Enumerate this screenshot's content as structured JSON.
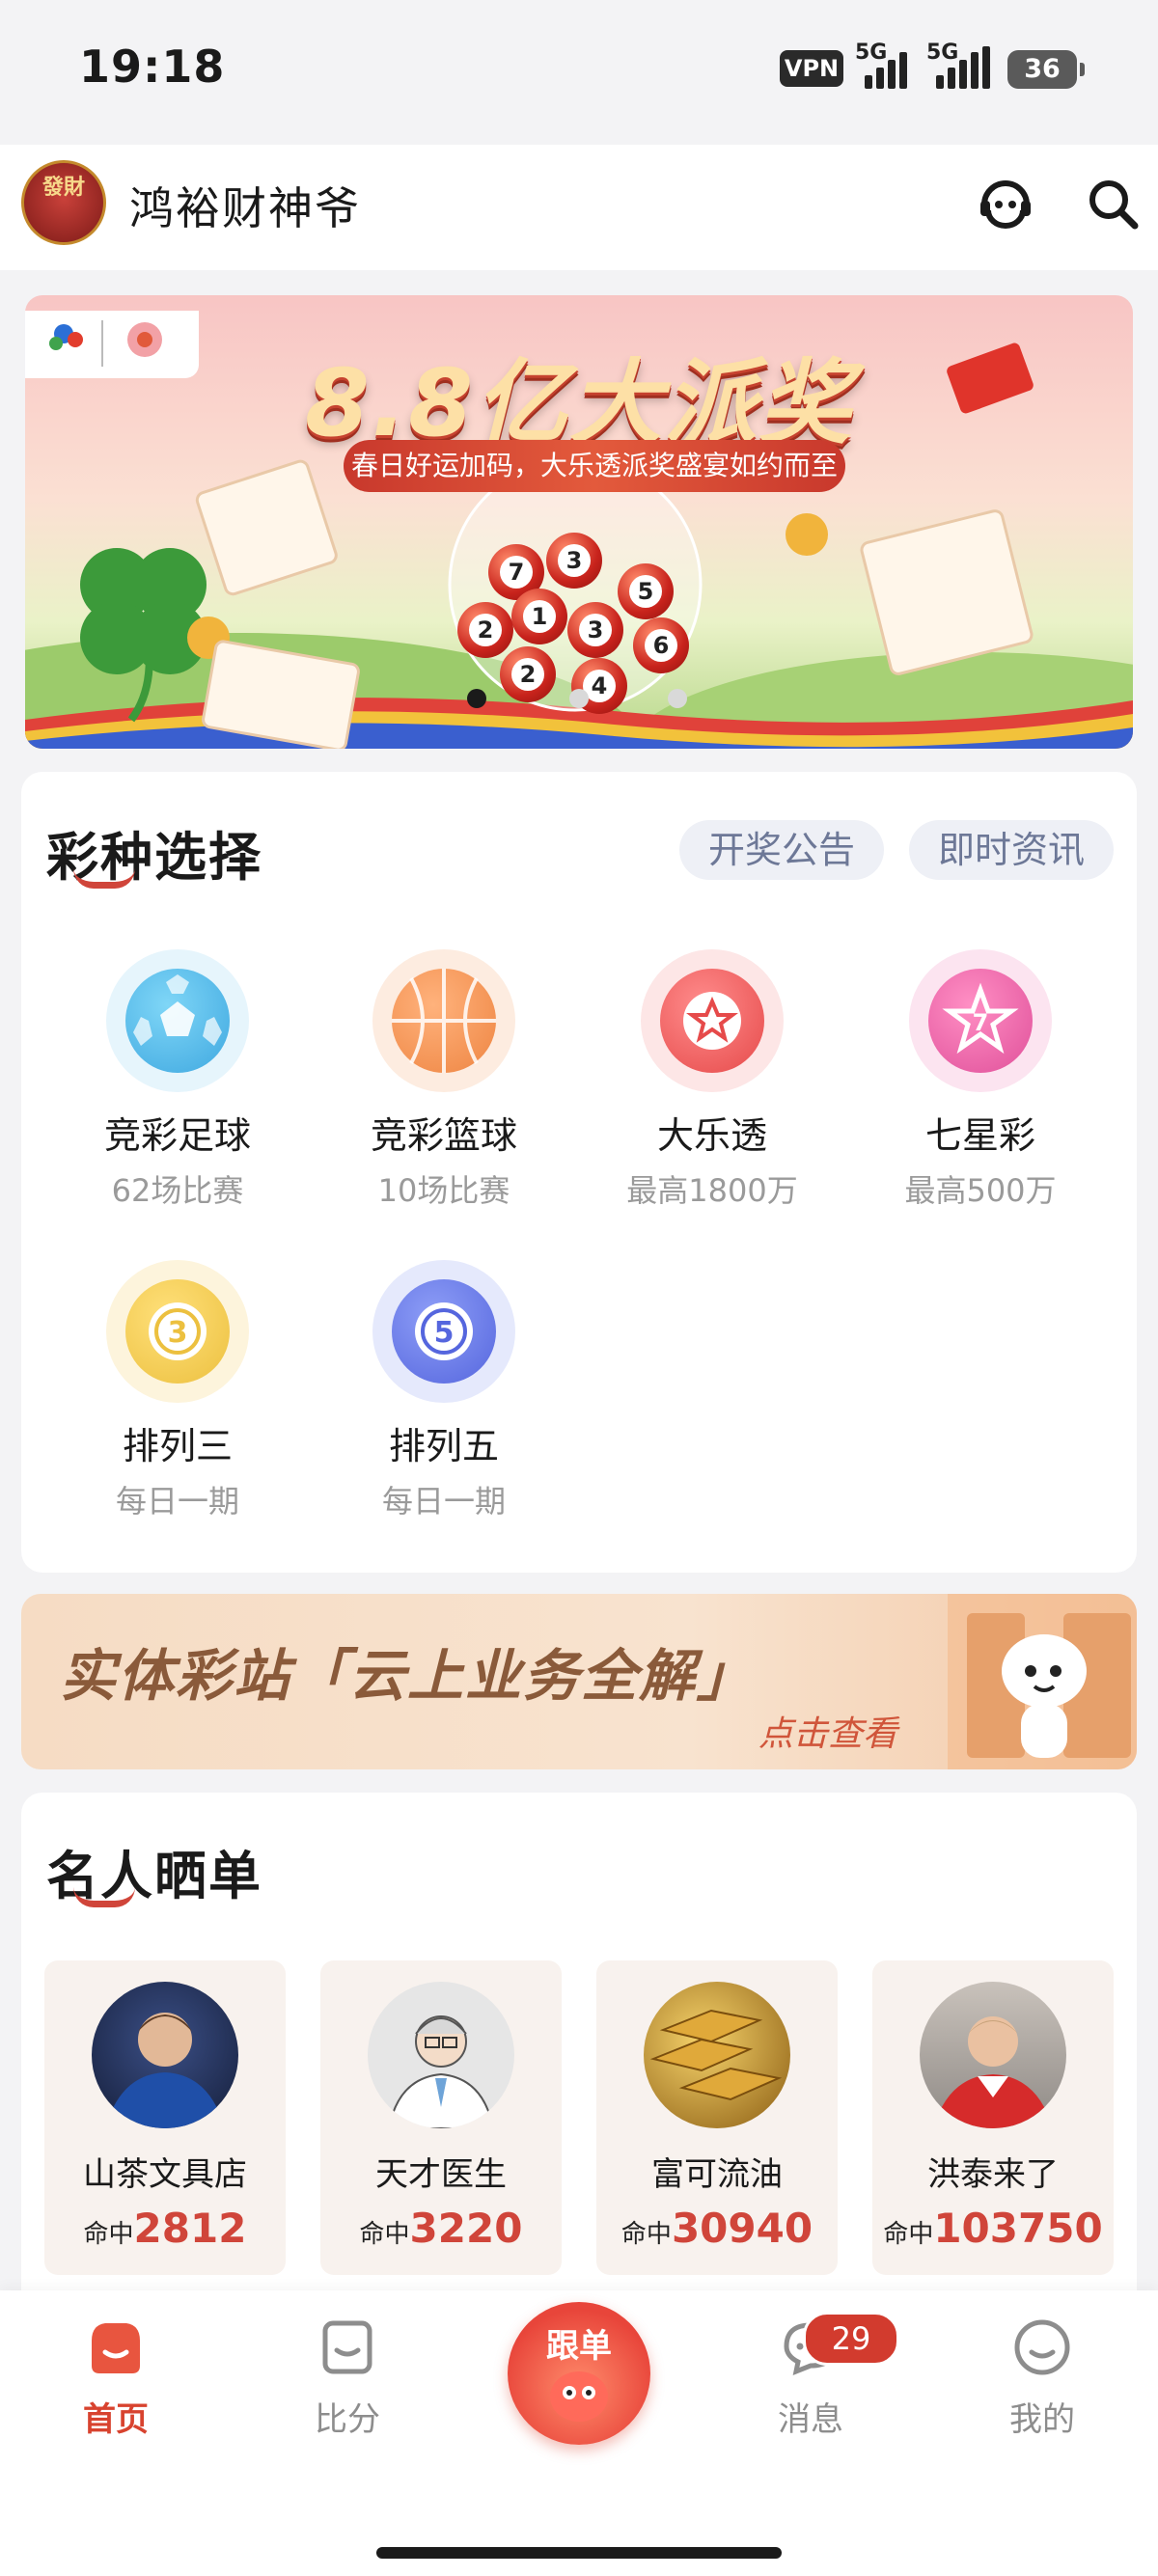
{
  "status_bar": {
    "time": "19:18",
    "vpn": "VPN",
    "net1": "5G",
    "net2": "5G",
    "battery": "36"
  },
  "header": {
    "app_name": "鸿裕财神爷",
    "logo_text": "發財"
  },
  "banner": {
    "title": "8.8亿大派奖",
    "subtitle": "春日好运加码，大乐透派奖盛宴如约而至",
    "balls": [
      "7",
      "3",
      "1",
      "5",
      "2",
      "3",
      "6",
      "2",
      "4"
    ],
    "slide_count": 3,
    "active_slide": 1
  },
  "lottery_section": {
    "title": "彩种选择",
    "pills": [
      "开奖公告",
      "即时资讯"
    ],
    "items": [
      {
        "name": "竞彩足球",
        "desc": "62场比赛",
        "icon": "soccer-ball-icon",
        "color": "#5cc3ee"
      },
      {
        "name": "竞彩篮球",
        "desc": "10场比赛",
        "icon": "basketball-icon",
        "color": "#f39a55"
      },
      {
        "name": "大乐透",
        "desc": "最高1800万",
        "icon": "star-ball-icon",
        "color": "#ec5a5a"
      },
      {
        "name": "七星彩",
        "desc": "最高500万",
        "icon": "seven-star-icon",
        "color": "#e6609e"
      },
      {
        "name": "排列三",
        "desc": "每日一期",
        "icon": "number-three-ball-icon",
        "color": "#efc94b"
      },
      {
        "name": "排列五",
        "desc": "每日一期",
        "icon": "number-five-ball-icon",
        "color": "#6479e8"
      }
    ]
  },
  "promo": {
    "title": "实体彩站「云上业务全解」",
    "cta": "点击查看"
  },
  "celebrity_section": {
    "title": "名人晒单",
    "hit_label": "命中",
    "items": [
      {
        "name": "山茶文具店",
        "hits": "2812"
      },
      {
        "name": "天才医生",
        "hits": "3220"
      },
      {
        "name": "富可流油",
        "hits": "30940"
      },
      {
        "name": "洪泰来了",
        "hits": "103750"
      }
    ]
  },
  "tabbar": {
    "tabs": [
      {
        "label": "首页",
        "active": true
      },
      {
        "label": "比分",
        "active": false
      },
      {
        "label": "跟单",
        "active": false
      },
      {
        "label": "消息",
        "active": false
      },
      {
        "label": "我的",
        "active": false
      }
    ],
    "message_badge": "29"
  },
  "colors": {
    "accent": "#d0453a",
    "pill_text": "#6d7897",
    "muted": "#9a9a9a"
  }
}
